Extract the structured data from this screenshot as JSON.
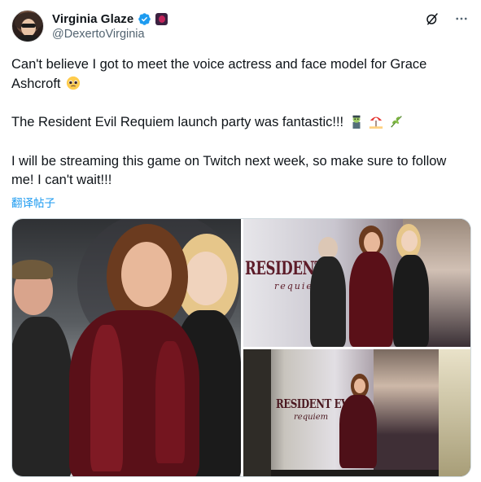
{
  "author": {
    "display_name": "Virginia Glaze",
    "handle": "@DexertoVirginia",
    "avatar_icon": "profile-avatar",
    "verified_icon": "verified-badge-icon",
    "affiliate_icon": "affiliate-badge-icon"
  },
  "header_icons": [
    "grok-icon",
    "more-options-icon"
  ],
  "tweet": {
    "paragraphs": [
      {
        "text": "Can't believe I got to meet the voice actress and face model for Grace Ashcroft",
        "emojis": [
          "pleading-face-emoji"
        ]
      },
      {
        "text": "The Resident Evil Requiem launch party was fantastic!!!",
        "emojis": [
          "zombie-emoji",
          "beach-umbrella-emoji",
          "herb-emoji"
        ]
      },
      {
        "text": "I will be streaming this game on Twitch next week, so make sure to follow me! I can't wait!!!",
        "emojis": []
      }
    ],
    "translate_label": "翻译帖子"
  },
  "media": {
    "posters": [
      {
        "title": "RESIDENT E",
        "subtitle": "requie"
      },
      {
        "title": "RESIDENT EVIL",
        "subtitle": "requiem"
      }
    ]
  },
  "colors": {
    "text": "#0f1419",
    "secondary": "#536471",
    "link": "#1d9bf0",
    "verified": "#1d9bf0",
    "border": "#cfd9de"
  }
}
